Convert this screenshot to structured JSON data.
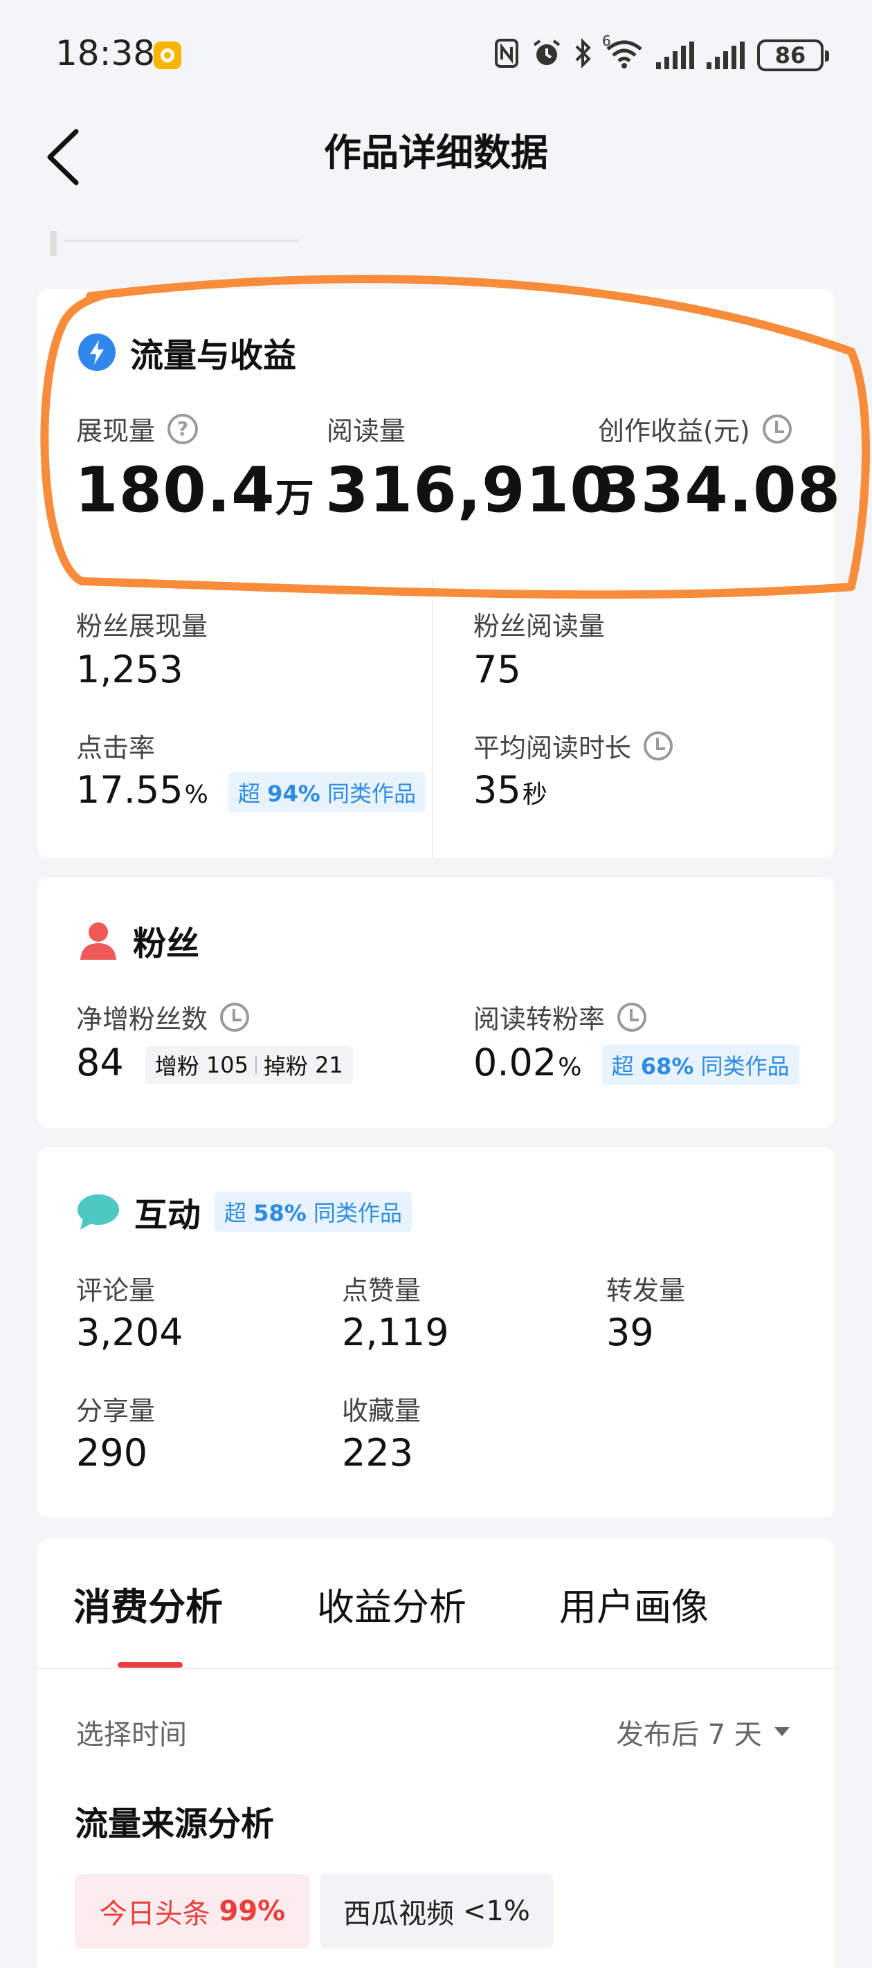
{
  "status_bar": {
    "time": "18:38",
    "battery": "86",
    "network": "6"
  },
  "nav": {
    "title": "作品详细数据"
  },
  "traffic": {
    "title": "流量与收益",
    "impressions": {
      "label": "展现量",
      "value": "180.4",
      "unit": "万"
    },
    "reads": {
      "label": "阅读量",
      "value": "316,910"
    },
    "earnings": {
      "label": "创作收益(元)",
      "value": "334.08"
    },
    "fan_impressions": {
      "label": "粉丝展现量",
      "value": "1,253"
    },
    "fan_reads": {
      "label": "粉丝阅读量",
      "value": "75"
    },
    "ctr": {
      "label": "点击率",
      "value": "17.55",
      "unit": "%",
      "badge_prefix": "超",
      "badge_pct": "94%",
      "badge_suffix": "同类作品"
    },
    "avg_read_time": {
      "label": "平均阅读时长",
      "value": "35",
      "unit": "秒"
    }
  },
  "fans": {
    "title": "粉丝",
    "net_gain": {
      "label": "净增粉丝数",
      "value": "84",
      "gain_label": "增粉",
      "gain": "105",
      "loss_label": "掉粉",
      "loss": "21"
    },
    "conversion": {
      "label": "阅读转粉率",
      "value": "0.02",
      "unit": "%",
      "badge_prefix": "超",
      "badge_pct": "68%",
      "badge_suffix": "同类作品"
    }
  },
  "interaction": {
    "title": "互动",
    "badge_prefix": "超",
    "badge_pct": "58%",
    "badge_suffix": "同类作品",
    "comments": {
      "label": "评论量",
      "value": "3,204"
    },
    "likes": {
      "label": "点赞量",
      "value": "2,119"
    },
    "forwards": {
      "label": "转发量",
      "value": "39"
    },
    "shares": {
      "label": "分享量",
      "value": "290"
    },
    "favorites": {
      "label": "收藏量",
      "value": "223"
    }
  },
  "analysis": {
    "tabs": [
      "消费分析",
      "收益分析",
      "用户画像"
    ],
    "select_time_label": "选择时间",
    "time_value": "发布后 7 天",
    "source_title": "流量来源分析",
    "sources": [
      {
        "name": "今日头条",
        "pct": "99%"
      },
      {
        "name": "西瓜视频",
        "pct": "<1%"
      }
    ]
  },
  "colors": {
    "accent_red": "#e9403f",
    "highlight_orange": "#f98c3a",
    "blue_badge": "#2c8ce3",
    "fan_icon": "#ee5a5a",
    "chat_icon": "#4cc9c3"
  }
}
